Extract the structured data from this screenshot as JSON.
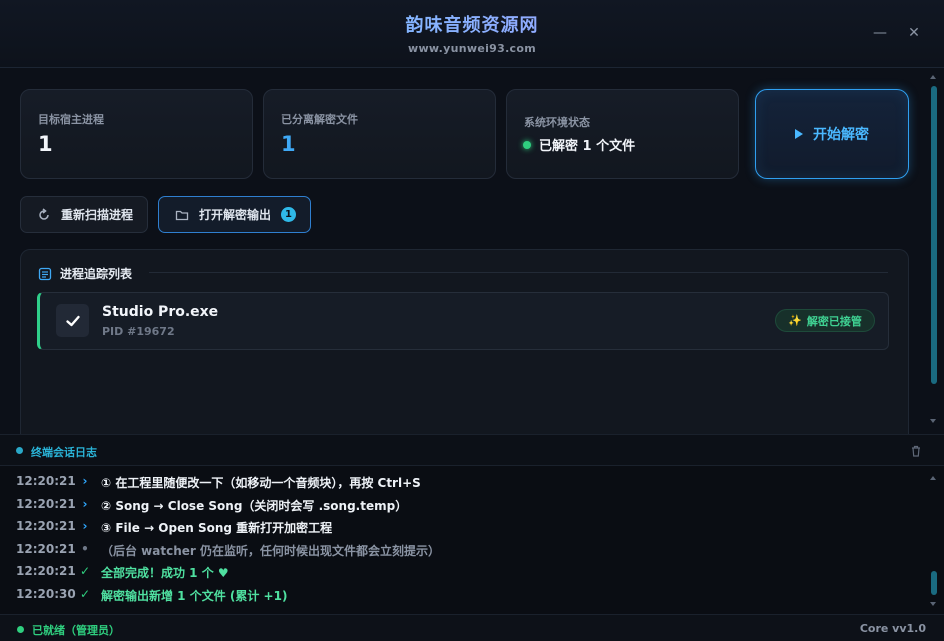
{
  "header": {
    "title": "韵味音频资源网",
    "subtitle": "www.yunwei93.com",
    "minimize_glyph": "—",
    "close_glyph": "✕"
  },
  "stats": {
    "host_process": {
      "label": "目标宿主进程",
      "value": "1"
    },
    "separated_files": {
      "label": "已分离解密文件",
      "value": "1"
    },
    "env_status": {
      "label": "系统环境状态",
      "value": "已解密 1 个文件",
      "dot_color": "#2fcf7f"
    }
  },
  "start_button": {
    "label": "开始解密",
    "icon": "play-icon"
  },
  "actions": {
    "rescan": {
      "label": "重新扫描进程",
      "icon": "refresh-icon"
    },
    "open_output": {
      "label": "打开解密输出",
      "icon": "folder-icon",
      "badge": "1"
    }
  },
  "process_panel": {
    "title": "进程追踪列表",
    "icon": "list-icon",
    "rows": [
      {
        "name": "Studio Pro.exe",
        "pid": "PID #19672",
        "tag": "解密已接管",
        "tag_icon": "sparkle-icon",
        "checked": true
      }
    ]
  },
  "log": {
    "title": "终端会话日志",
    "lines": [
      {
        "time": "12:20:21",
        "mark": "›",
        "kind": "arrow",
        "msg": "① 在工程里随便改一下（如移动一个音频块），再按 Ctrl+S"
      },
      {
        "time": "12:20:21",
        "mark": "›",
        "kind": "arrow",
        "msg": "② Song → Close Song（关闭时会写 .song.temp）"
      },
      {
        "time": "12:20:21",
        "mark": "›",
        "kind": "arrow",
        "msg": "③ File → Open Song 重新打开加密工程"
      },
      {
        "time": "12:20:21",
        "mark": "•",
        "kind": "dot",
        "msg": "（后台 watcher 仍在监听，任何时候出现文件都会立刻提示）"
      },
      {
        "time": "12:20:21",
        "mark": "✓",
        "kind": "check",
        "msg": "全部完成！成功 1 个 ♥"
      },
      {
        "time": "12:20:30",
        "mark": "✓",
        "kind": "check",
        "msg": "解密输出新增 1 个文件 (累计 +1)"
      }
    ]
  },
  "statusbar": {
    "status": "已就绪（管理员）",
    "version": "Core vv1.0"
  },
  "colors": {
    "accent_blue": "#3fa9f5",
    "accent_green": "#2fcf7f",
    "accent_cyan": "#2ab4d8"
  }
}
